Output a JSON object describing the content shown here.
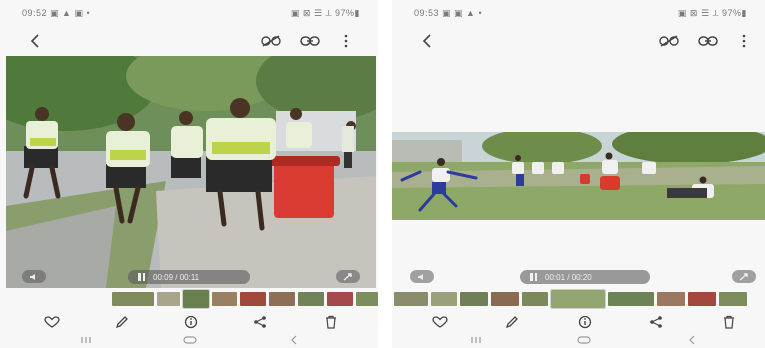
{
  "left": {
    "status": {
      "time": "09:52",
      "icons": "▣ ▲ ▣ •",
      "system": "▣ ⊠ ☰ ⟂ 97%▮"
    },
    "video": {
      "elapsed": "00:09",
      "duration": "00:11"
    }
  },
  "right": {
    "status": {
      "time": "09:53",
      "icons": "▣ ▣ ▲ •",
      "system": "▣ ⊠ ☰ ⟂ 97%▮"
    },
    "video": {
      "elapsed": "00:01",
      "duration": "00:20"
    }
  },
  "icons": {
    "back": "back-arrow-icon",
    "link_off": "link-off-icon",
    "link": "link-icon",
    "more": "more-vert-icon",
    "favorite": "heart-icon",
    "edit": "pencil-icon",
    "info": "info-icon",
    "share": "share-icon",
    "delete": "trash-icon"
  },
  "colors": {
    "background": "#f7f7f7",
    "icon": "#444444",
    "pill": "#5a5a5a"
  }
}
